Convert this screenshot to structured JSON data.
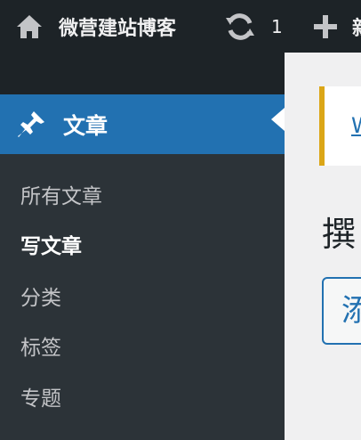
{
  "adminbar": {
    "site_title": "微营建站博客",
    "updates_count": "1",
    "new_label": "新"
  },
  "sidebar": {
    "current_menu": "文章",
    "submenu": [
      {
        "label": "所有文章"
      },
      {
        "label": "写文章",
        "current": true
      },
      {
        "label": "分类"
      },
      {
        "label": "标签"
      },
      {
        "label": "专题"
      }
    ]
  },
  "main": {
    "notice_link": "W",
    "page_title": "撰",
    "add_button_label": "添"
  },
  "colors": {
    "adminbar_bg": "#1d2327",
    "menu_current_bg": "#2271b1",
    "submenu_bg": "#2c3338",
    "notice_border": "#dba617"
  }
}
